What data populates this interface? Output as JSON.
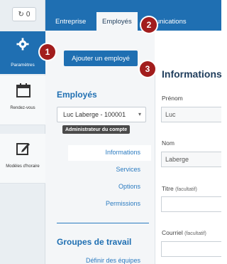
{
  "counter": {
    "value": "0",
    "icon": "refresh-icon"
  },
  "sidebar": {
    "settings_label": "Paramètres",
    "appointments_label": "Rendez-vous",
    "templates_label": "Modèles d'horaire"
  },
  "tabs": [
    {
      "label": "Entreprise"
    },
    {
      "label": "Employés"
    },
    {
      "label": "mmunications"
    }
  ],
  "badges": [
    "1",
    "2",
    "3"
  ],
  "employees": {
    "add_button": "Ajouter un employé",
    "section_title": "Employés",
    "selected_employee": "Luc Laberge - 100001",
    "role_badge": "Administrateur du compte",
    "nav": [
      "Informations",
      "Services",
      "Options",
      "Permissions"
    ]
  },
  "groups": {
    "title": "Groupes de travail",
    "define_link": "Définir des équipes"
  },
  "form": {
    "title": "Informations",
    "first_name_label": "Prénom",
    "first_name_value": "Luc",
    "last_name_label": "Nom",
    "last_name_value": "Laberge",
    "title_label": "Titre",
    "title_optional": "(facultatif)",
    "email_label": "Courriel",
    "email_optional": "(facultatif)"
  },
  "colors": {
    "primary": "#1f6fb2",
    "badge": "#a21d1d",
    "link": "#2b7bc0"
  }
}
